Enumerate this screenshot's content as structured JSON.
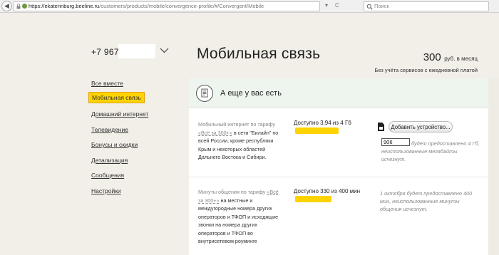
{
  "browser": {
    "url_host": "https://ekaterinburg.beeline.ru",
    "url_path": "/customers/products/mobile/convergence-profile/#/Convergent/Mobile",
    "search_placeholder": "Поиск",
    "reload": "C",
    "dropdown": "▾"
  },
  "sidebar": {
    "phone": "+7 967",
    "items": [
      {
        "label": "Все вместе"
      },
      {
        "label": "Мобильная связь"
      },
      {
        "label": "Домашний интернет"
      },
      {
        "label": "Телевидение"
      },
      {
        "label": "Бонусы и скидки"
      },
      {
        "label": "Детализация"
      },
      {
        "label": "Сообщения"
      },
      {
        "label": "Настройки"
      }
    ],
    "active_index": 1
  },
  "header": {
    "title": "Мобильная связь",
    "price_value": "300",
    "price_unit": "руб. в месяц",
    "price_note": "Без учёта сервисов с ежедневной платой"
  },
  "panel": {
    "title": "А еще у вас есть",
    "internet": {
      "lead": "Мобильный интернет по тарифу",
      "tariff": "«Всё за 300+»",
      "rest": "в сети \"Билайн\" по всей России, кроме республики Крым и некоторых областей Дальнего Востока и Сибири.",
      "available": "Доступно 3,94 из 4 Гб",
      "fraction": 0.985,
      "button": "Добавить устройство...",
      "input_value": "906",
      "note": "будет предоставлено 4 Гб, неиспользованные мегабайты исчезнут."
    },
    "minutes": {
      "lead": "Минуты общения по тарифу",
      "tariff": "«Всё за 300+»",
      "rest": "на местные и междугородные номера других операторов и ТФОП и исходящие звонки на номера других операторов и ТФОП во внутрисетевом роуминге",
      "available": "Доступно 330 из 400 мин",
      "fraction": 0.825,
      "note": "1 октября будет предоставлено 400 мин, неиспользованные минуты общения исчезнут."
    }
  },
  "colors": {
    "accent": "#fed302",
    "background": "#f2efe8",
    "panel_head": "#eef5ee"
  }
}
